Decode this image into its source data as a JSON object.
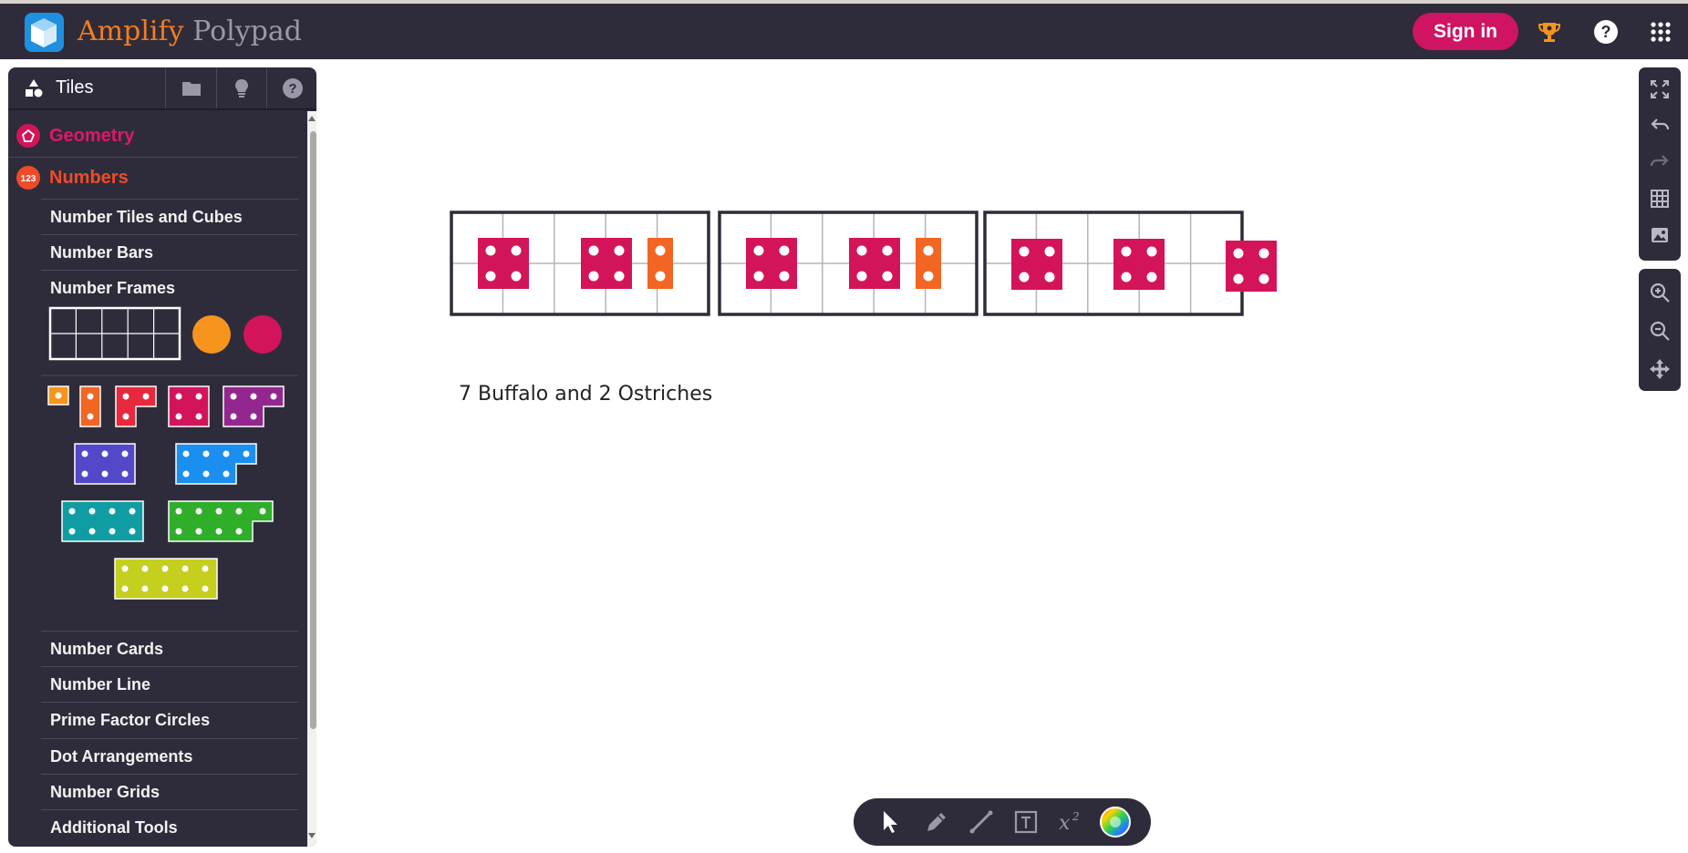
{
  "app": {
    "brand_primary": "Amplify",
    "brand_secondary": "Polypad"
  },
  "header": {
    "signin_label": "Sign in"
  },
  "sidebar": {
    "active_tab": "Tiles",
    "categories": [
      {
        "label": "Geometry",
        "color": "#d4145a"
      },
      {
        "label": "Numbers",
        "color": "#ef4b2a"
      }
    ],
    "number_items_top": [
      "Number Tiles and Cubes",
      "Number Bars",
      "Number Frames"
    ],
    "number_items_bottom": [
      "Number Cards",
      "Number Line",
      "Prime Factor Circles",
      "Dot Arrangements",
      "Number Grids",
      "Additional Tools"
    ]
  },
  "canvas": {
    "caption": "7 Buffalo and 2 Ostriches",
    "frames": 3,
    "tile_colors": {
      "four": "#d4145a",
      "two": "#f26522"
    }
  },
  "colors": {
    "dark": "#2e2c3a",
    "accent": "#cf1463",
    "trophy": "#f7941d"
  },
  "icons": {
    "right_toolbar": [
      "fullscreen-icon",
      "undo-icon",
      "redo-icon",
      "grid-icon",
      "image-icon",
      "zoom-in-icon",
      "zoom-out-icon",
      "pan-icon"
    ],
    "bottom_toolbar": [
      "pointer-icon",
      "pen-icon",
      "line-icon",
      "text-icon",
      "equation-icon",
      "color-wheel-icon"
    ]
  }
}
